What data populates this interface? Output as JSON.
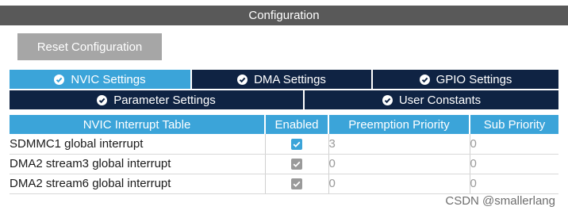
{
  "window": {
    "title": "Configuration"
  },
  "toolbar": {
    "reset_label": "Reset Configuration"
  },
  "tabs_row1": [
    {
      "label": "NVIC Settings",
      "active": true
    },
    {
      "label": "DMA Settings",
      "active": false
    },
    {
      "label": "GPIO Settings",
      "active": false
    }
  ],
  "tabs_row2": [
    {
      "label": "Parameter Settings",
      "active": false
    },
    {
      "label": "User Constants",
      "active": false
    }
  ],
  "table": {
    "headers": [
      "NVIC Interrupt Table",
      "Enabled",
      "Preemption Priority",
      "Sub Priority"
    ],
    "rows": [
      {
        "name": "SDMMC1 global interrupt",
        "enabled": true,
        "editable": true,
        "preemption": "3",
        "sub": "0"
      },
      {
        "name": "DMA2 stream3 global interrupt",
        "enabled": true,
        "editable": false,
        "preemption": "0",
        "sub": "0"
      },
      {
        "name": "DMA2 stream6 global interrupt",
        "enabled": true,
        "editable": false,
        "preemption": "0",
        "sub": "0"
      }
    ]
  },
  "watermark": "CSDN @smallerlang",
  "colors": {
    "accent": "#3ba4d9",
    "dark_tab": "#0f2343",
    "title_bar": "#595959",
    "button": "#a6a6a6"
  },
  "icons": {
    "tab_check": "check-circle-icon",
    "row_checkbox": "checkbox-icon"
  }
}
